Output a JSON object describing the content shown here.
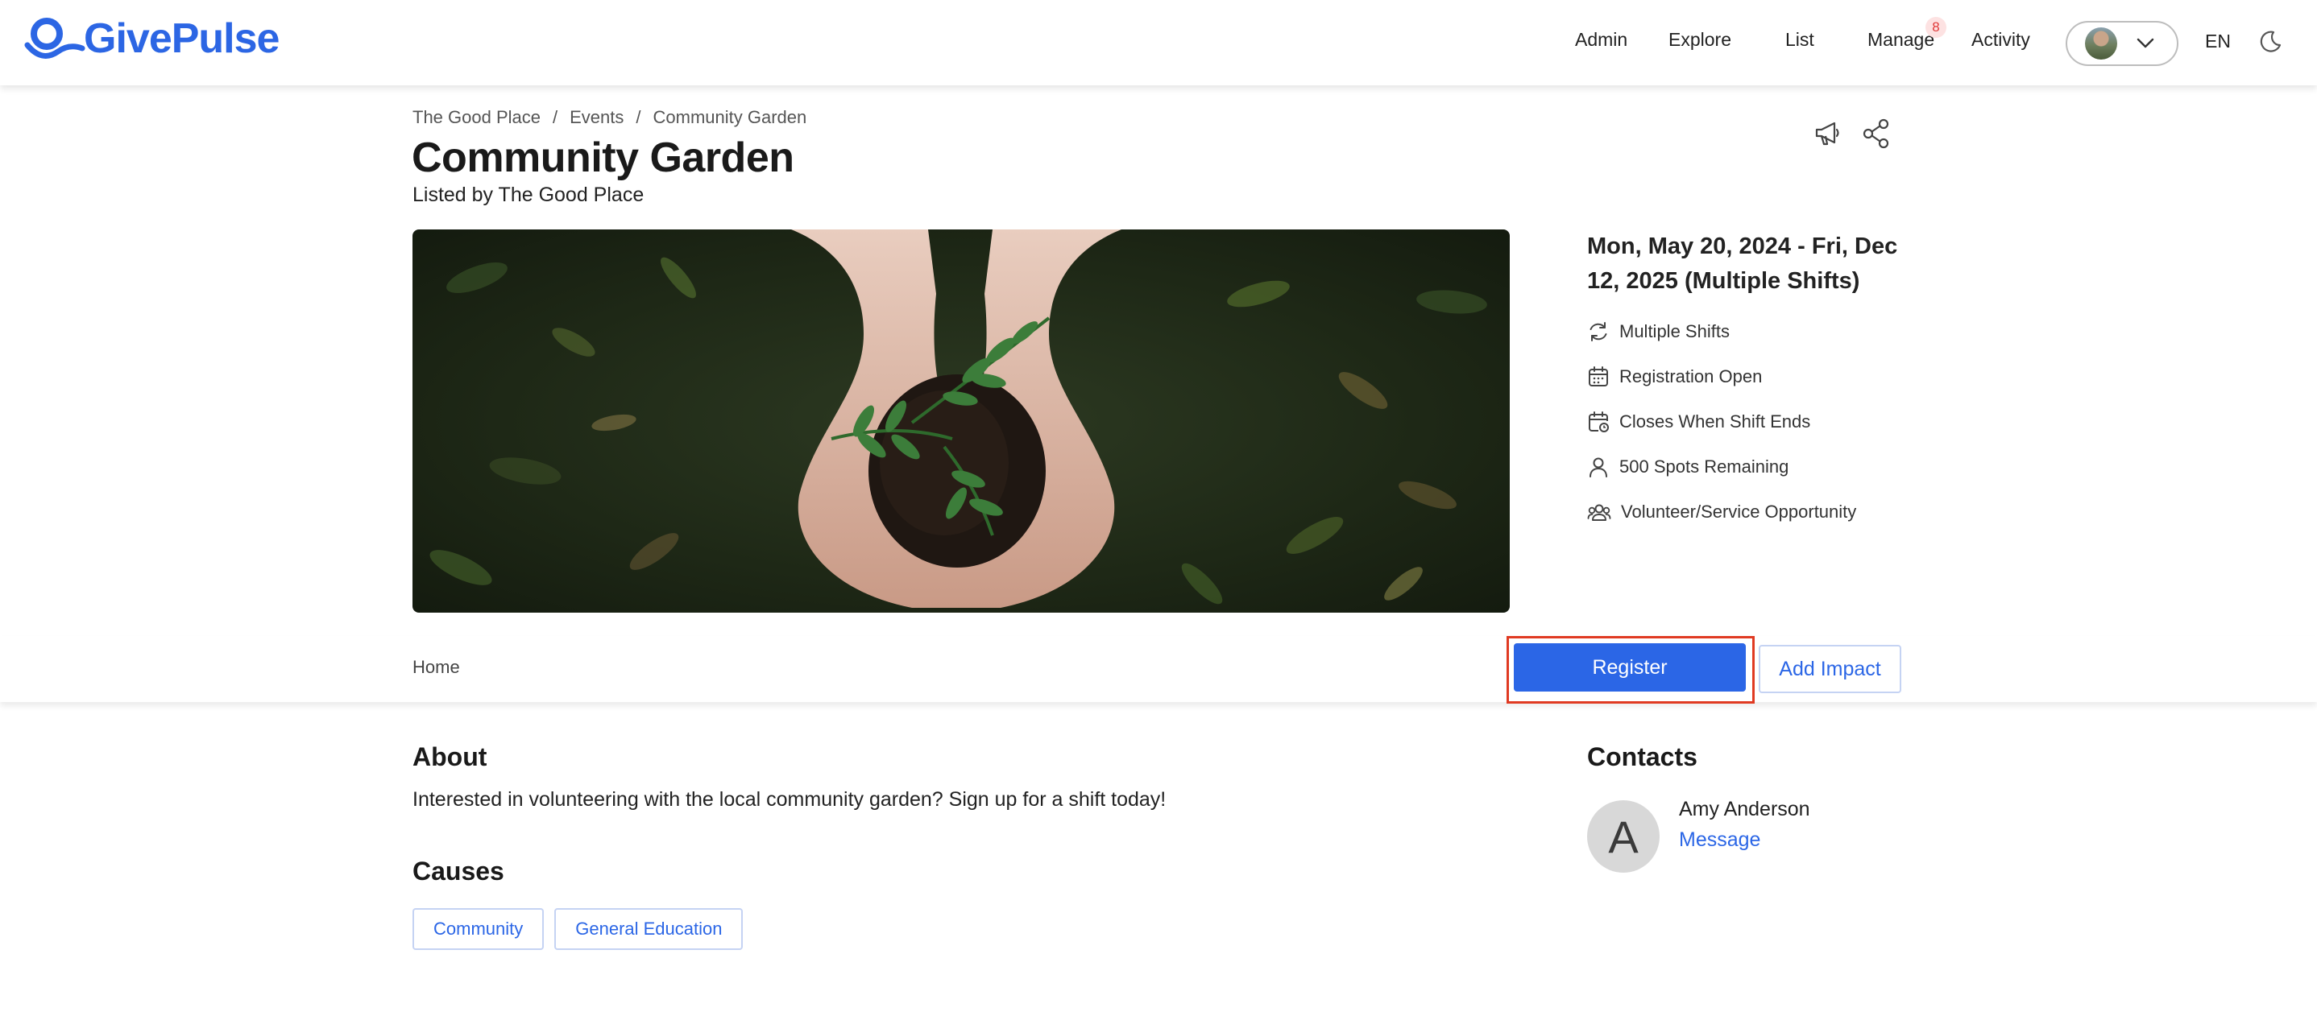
{
  "brand": {
    "name": "GivePulse",
    "color": "#2c66e4"
  },
  "nav": {
    "items": [
      "Admin",
      "Explore",
      "List",
      "Manage",
      "Activity"
    ],
    "manage_badge": "8",
    "language": "EN"
  },
  "breadcrumb": [
    "The Good Place",
    "Events",
    "Community Garden"
  ],
  "page": {
    "title": "Community Garden",
    "listed_by": "Listed by The Good Place"
  },
  "info": {
    "date": "Mon, May 20, 2024 - Fri, Dec 12, 2025 (Multiple Shifts)",
    "rows": [
      {
        "icon": "refresh-icon",
        "text": "Multiple Shifts"
      },
      {
        "icon": "calendar-icon",
        "text": "Registration Open"
      },
      {
        "icon": "calendar-clock-icon",
        "text": "Closes When Shift Ends"
      },
      {
        "icon": "person-icon",
        "text": "500 Spots Remaining"
      },
      {
        "icon": "group-icon",
        "text": "Volunteer/Service Opportunity"
      }
    ]
  },
  "tabs": {
    "home": "Home"
  },
  "actions": {
    "register": "Register",
    "add_impact": "Add Impact",
    "primary_color": "#2b66e6"
  },
  "about": {
    "heading": "About",
    "text": "Interested in volunteering with the local community garden? Sign up for a shift today!"
  },
  "causes": {
    "heading": "Causes",
    "items": [
      "Community",
      "General Education"
    ]
  },
  "contacts": {
    "heading": "Contacts",
    "initial": "A",
    "name": "Amy Anderson",
    "message": "Message"
  }
}
